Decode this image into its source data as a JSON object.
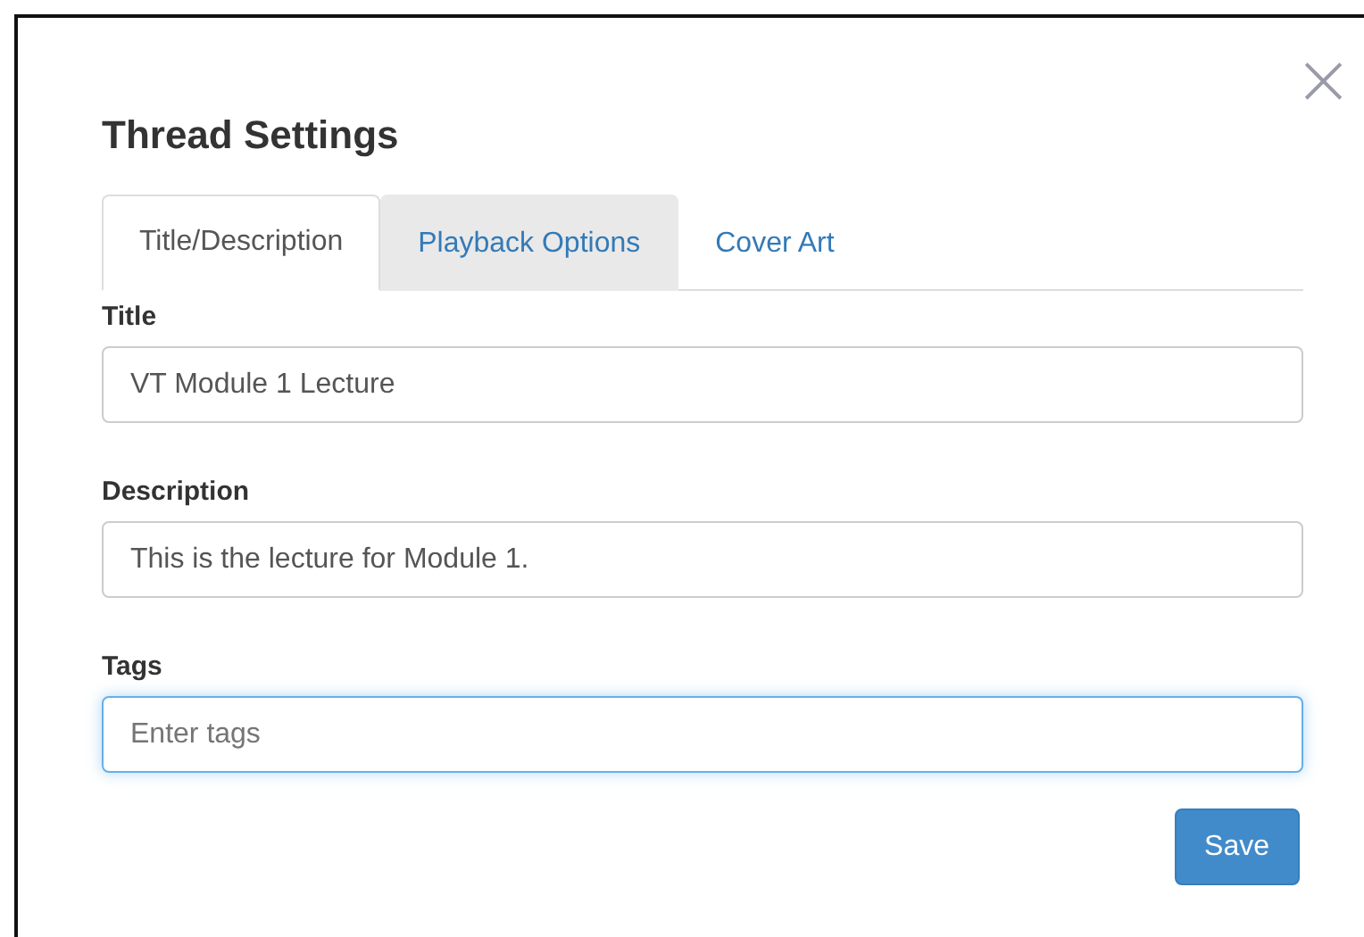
{
  "dialog": {
    "title": "Thread Settings",
    "close": "×"
  },
  "tabs": [
    {
      "label": "Title/Description",
      "selected": true,
      "hovered": false
    },
    {
      "label": "Playback Options",
      "selected": false,
      "hovered": true
    },
    {
      "label": "Cover Art",
      "selected": false,
      "hovered": false
    }
  ],
  "fields": [
    {
      "label": "Title",
      "value": "VT Module 1 Lecture",
      "focused": false
    },
    {
      "label": "Description",
      "value": "This is the lecture for Module 1.",
      "focused": false
    },
    {
      "label": "Tags",
      "placeholder": "Enter tags",
      "focused": true
    }
  ],
  "buttons": [
    "Save"
  ]
}
